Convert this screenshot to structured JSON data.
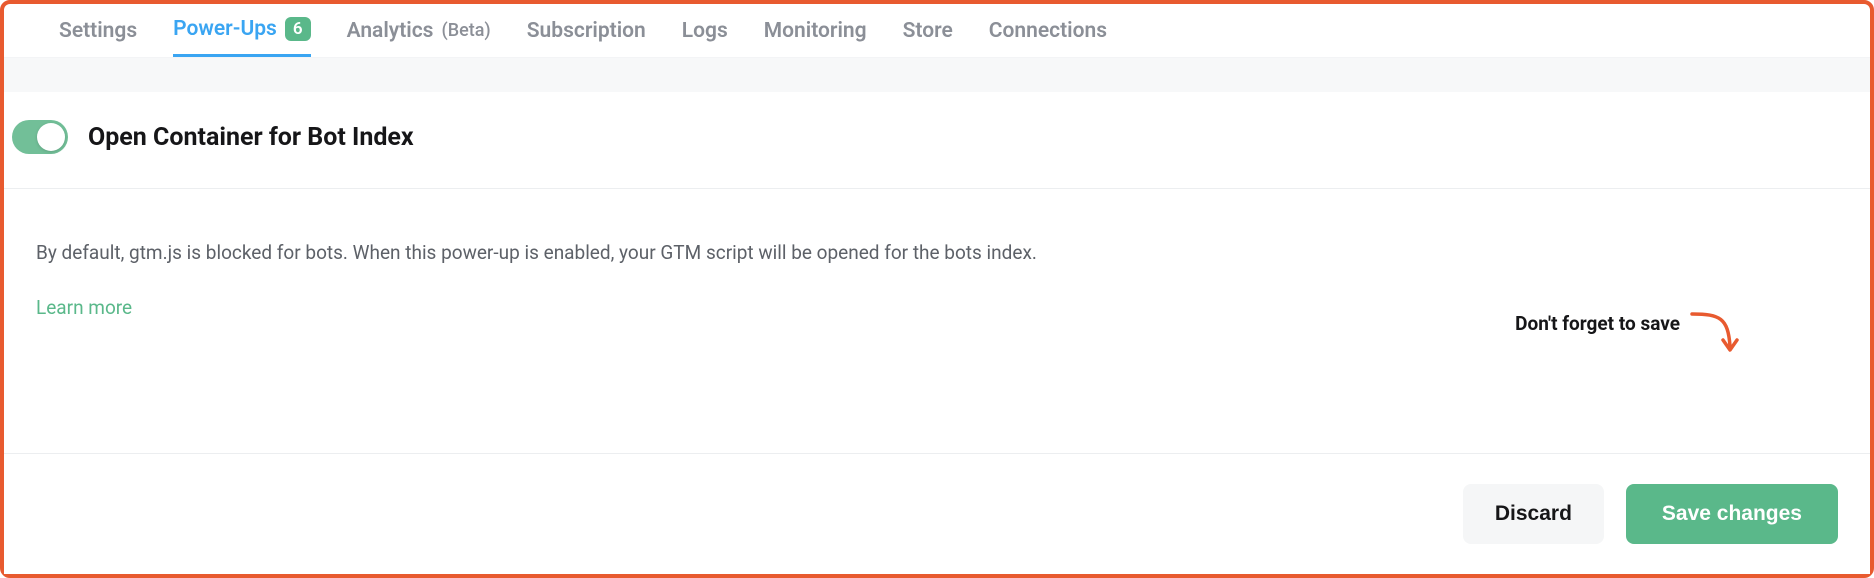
{
  "tabs": [
    {
      "label": "Settings",
      "active": false
    },
    {
      "label": "Power-Ups",
      "active": true,
      "badge": "6"
    },
    {
      "label": "Analytics",
      "active": false,
      "suffix": "(Beta)"
    },
    {
      "label": "Subscription",
      "active": false
    },
    {
      "label": "Logs",
      "active": false
    },
    {
      "label": "Monitoring",
      "active": false
    },
    {
      "label": "Store",
      "active": false
    },
    {
      "label": "Connections",
      "active": false
    }
  ],
  "feature": {
    "title": "Open Container for Bot Index",
    "toggle_on": true,
    "description": "By default, gtm.js is blocked for bots. When this power-up is enabled, your GTM script will be opened for the bots index.",
    "learn_more": "Learn more"
  },
  "reminder": {
    "text": "Don't forget to save"
  },
  "footer": {
    "discard_label": "Discard",
    "save_label": "Save changes"
  },
  "colors": {
    "accent_orange": "#e85a2f",
    "accent_blue": "#3aa5f2",
    "accent_green": "#5ab88a"
  }
}
